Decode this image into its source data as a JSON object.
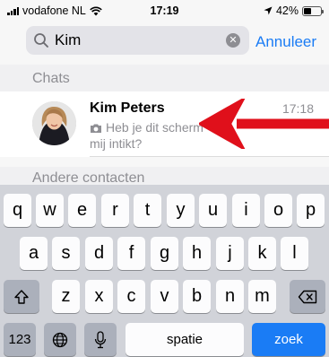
{
  "status_bar": {
    "carrier": "vodafone NL",
    "time": "17:19",
    "battery_text": "42%",
    "battery_level": 0.42
  },
  "search": {
    "value": "Kim",
    "cancel_label": "Annuleer"
  },
  "sections": {
    "chats": "Chats",
    "other_contacts": "Andere contacten"
  },
  "chat": {
    "name": "Kim Peters",
    "time": "17:18",
    "preview": "Heb je dit scherm",
    "preview_line2": "mij intikt?"
  },
  "keyboard": {
    "row1": [
      "q",
      "w",
      "e",
      "r",
      "t",
      "y",
      "u",
      "i",
      "o",
      "p"
    ],
    "row2": [
      "a",
      "s",
      "d",
      "f",
      "g",
      "h",
      "j",
      "k",
      "l"
    ],
    "row3": [
      "z",
      "x",
      "c",
      "v",
      "b",
      "n",
      "m"
    ],
    "numbers_label": "123",
    "space_label": "spatie",
    "search_label": "zoek"
  },
  "icons": {
    "signal": "signal-icon",
    "wifi": "wifi-icon",
    "location": "location-arrow-icon",
    "battery": "battery-icon",
    "search": "search-icon",
    "clear": "clear-icon",
    "camera": "camera-icon",
    "shift": "shift-icon",
    "backspace": "backspace-icon",
    "globe": "globe-icon",
    "mic": "microphone-icon",
    "arrow": "red-arrow-icon"
  },
  "colors": {
    "accent": "#1a7cf5",
    "arrow": "#e0101b"
  }
}
